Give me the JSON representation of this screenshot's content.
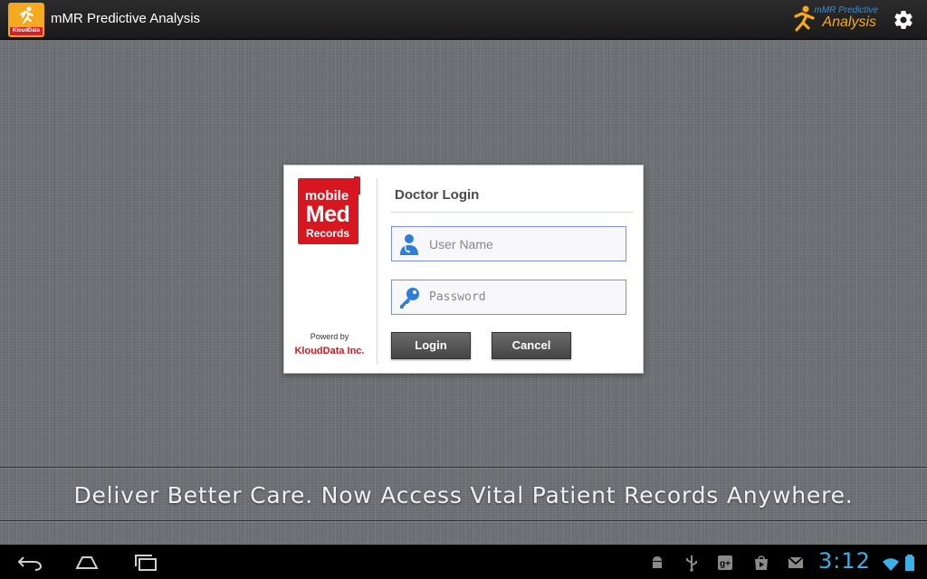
{
  "app": {
    "title": "mMR Predictive Analysis",
    "icon_brand": "KloudData",
    "header_logo_line1": "mMR Predictive",
    "header_logo_line2": "Analysis",
    "settings_icon": "gear-icon"
  },
  "login_card": {
    "logo_line1": "mobile",
    "logo_line2": "Med",
    "logo_line3": "Records",
    "powered_by": "Powerd by",
    "company": "KloudData Inc.",
    "title": "Doctor Login",
    "username_placeholder": "User Name",
    "password_placeholder": "Password",
    "login_label": "Login",
    "cancel_label": "Cancel",
    "username_icon": "doctor-user-icon",
    "password_icon": "key-icon"
  },
  "tagline": "Deliver Better Care. Now Access Vital Patient Records Anywhere.",
  "system_bar": {
    "clock": "3:12",
    "nav_icons": [
      "back-icon",
      "home-icon",
      "recent-apps-icon"
    ],
    "status_icons": [
      "android-debug-icon",
      "usb-icon",
      "google-plus-icon",
      "play-store-icon",
      "gmail-icon",
      "wifi-icon",
      "battery-icon"
    ]
  },
  "colors": {
    "accent_orange": "#f6a81e",
    "brand_red": "#d7161f",
    "clock_blue": "#3ab0e6",
    "field_border": "#7d8fd8"
  }
}
